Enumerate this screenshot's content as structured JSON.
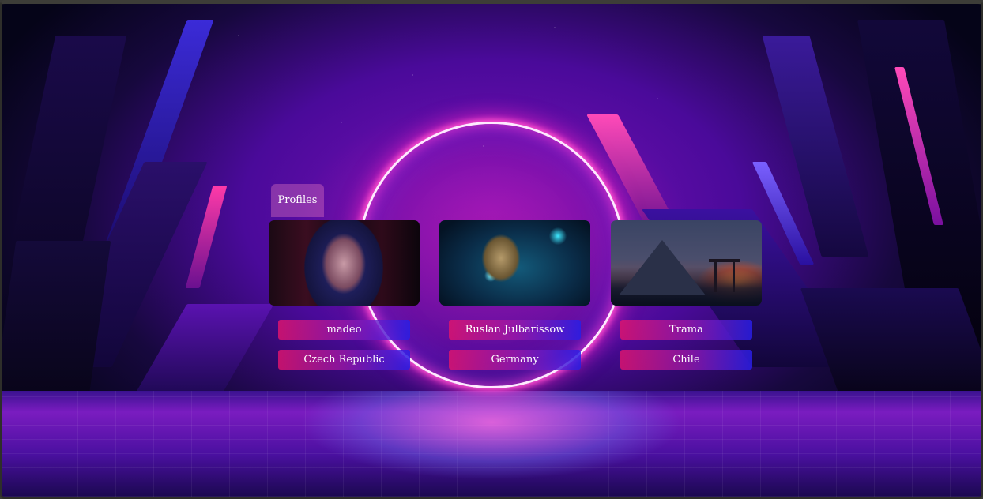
{
  "tab": {
    "label": "Profiles"
  },
  "profiles": [
    {
      "name": "madeo",
      "country": "Czech Republic",
      "image": "hooded-figure-art"
    },
    {
      "name": "Ruslan Julbarissow",
      "country": "Germany",
      "image": "groot-art"
    },
    {
      "name": "Trama",
      "country": "Chile",
      "image": "torii-landscape-art"
    }
  ],
  "colors": {
    "pill_start": "#dc146e",
    "pill_end": "#281ee6",
    "ring_glow": "#ff50d0",
    "background_deep": "#4a0a9a"
  }
}
